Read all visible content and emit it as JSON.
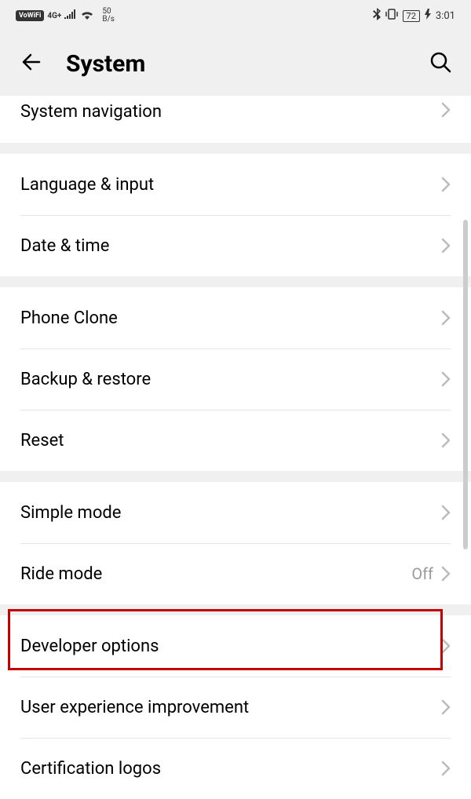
{
  "status": {
    "vowifi": "VoWiFi",
    "network": "4G+",
    "speed_num": "50",
    "speed_unit": "B/s",
    "battery": "72",
    "time": "3:01"
  },
  "header": {
    "title": "System"
  },
  "sections": [
    {
      "items": [
        {
          "label": "System navigation"
        }
      ]
    },
    {
      "items": [
        {
          "label": "Language & input"
        },
        {
          "label": "Date & time"
        }
      ]
    },
    {
      "items": [
        {
          "label": "Phone Clone"
        },
        {
          "label": "Backup & restore"
        },
        {
          "label": "Reset"
        }
      ]
    },
    {
      "items": [
        {
          "label": "Simple mode"
        },
        {
          "label": "Ride mode",
          "value": "Off"
        }
      ]
    },
    {
      "items": [
        {
          "label": "Developer options"
        },
        {
          "label": "User experience improvement"
        },
        {
          "label": "Certification logos"
        }
      ]
    }
  ]
}
